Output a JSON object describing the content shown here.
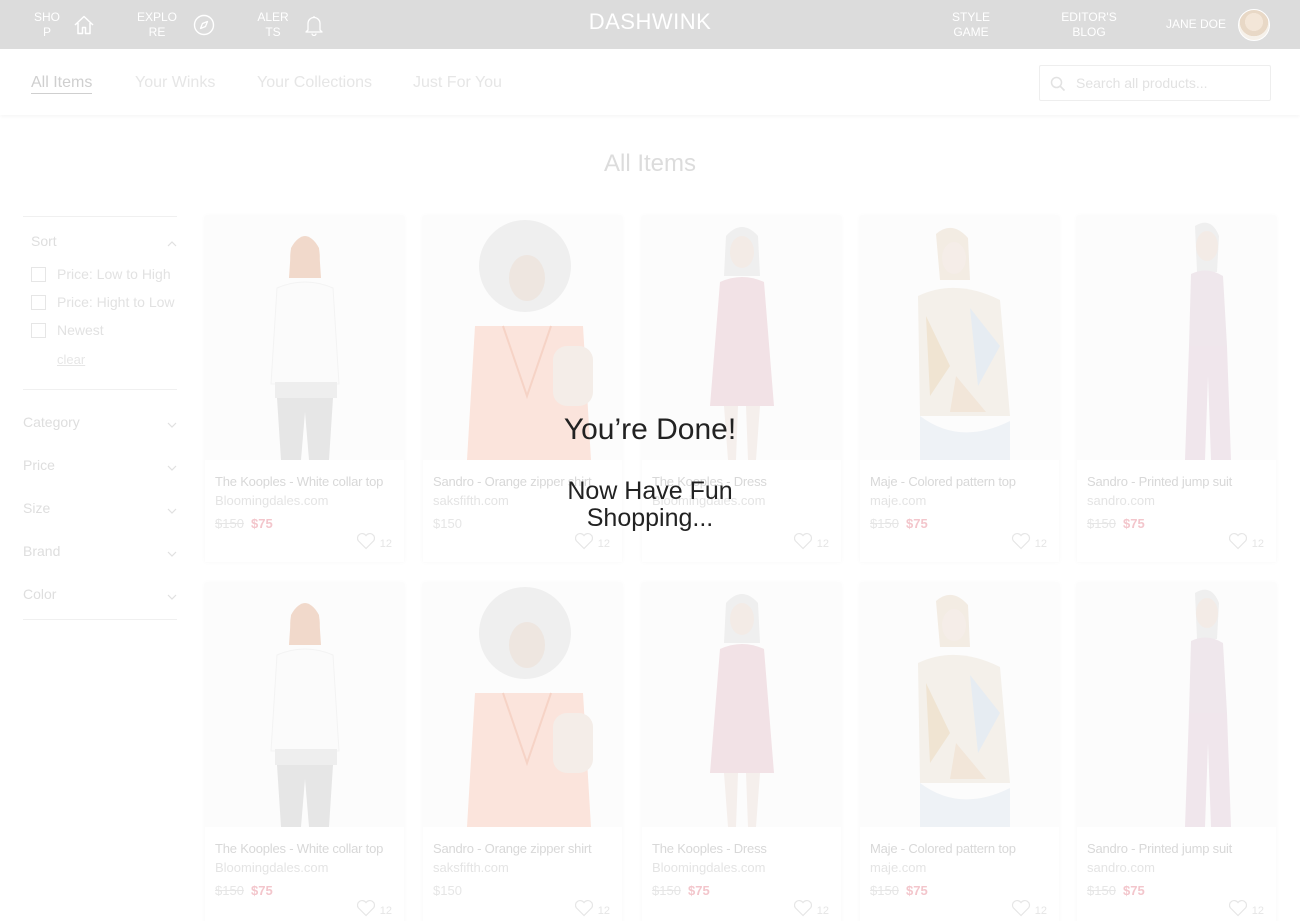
{
  "nav": {
    "shop_label": "SHOP",
    "explore_label": "EXPLORE",
    "alerts_label": "ALERTS",
    "brand": "DASHWINK",
    "style_game_label": "STYLE GAME",
    "editors_blog_label": "EDITOR'S BLOG",
    "user_name": "JANE DOE"
  },
  "tabs": [
    {
      "label": "All Items",
      "active": true
    },
    {
      "label": "Your Winks"
    },
    {
      "label": "Your Collections"
    },
    {
      "label": "Just For You"
    }
  ],
  "search": {
    "placeholder": "Search all products..."
  },
  "page_title": "All Items",
  "sidebar": {
    "sort": {
      "label": "Sort",
      "options": [
        "Price: Low to High",
        "Price: Hight to Low",
        "Newest"
      ],
      "clear_label": "clear"
    },
    "filters": [
      "Category",
      "Price",
      "Size",
      "Brand",
      "Color"
    ]
  },
  "products": [
    {
      "title": "The Kooples - White collar top",
      "store": "Bloomingdales.com",
      "old_price": "$150",
      "new_price": "$75",
      "likes": "12"
    },
    {
      "title": "Sandro - Orange zipper shirt",
      "store": "saksfifth.com",
      "old_price": "$150",
      "new_price": "",
      "likes": "12"
    },
    {
      "title": "The Kooples - Dress",
      "store": "Bloomingdales.com",
      "old_price": "",
      "new_price": "",
      "likes": "12"
    },
    {
      "title": "Maje - Colored pattern top",
      "store": "maje.com",
      "old_price": "$150",
      "new_price": "$75",
      "likes": "12"
    },
    {
      "title": "Sandro - Printed jump suit",
      "store": "sandro.com",
      "old_price": "$150",
      "new_price": "$75",
      "likes": "12"
    },
    {
      "title": "The Kooples - White collar top",
      "store": "Bloomingdales.com",
      "old_price": "$150",
      "new_price": "$75",
      "likes": "12"
    },
    {
      "title": "Sandro - Orange zipper shirt",
      "store": "saksfifth.com",
      "old_price": "$150",
      "new_price": "",
      "likes": "12"
    },
    {
      "title": "The Kooples - Dress",
      "store": "Bloomingdales.com",
      "old_price": "$150",
      "new_price": "$75",
      "likes": "12"
    },
    {
      "title": "Maje - Colored pattern top",
      "store": "maje.com",
      "old_price": "$150",
      "new_price": "$75",
      "likes": "12"
    },
    {
      "title": "Sandro - Printed jump suit",
      "store": "sandro.com",
      "old_price": "$150",
      "new_price": "$75",
      "likes": "12"
    }
  ],
  "overlay": {
    "title": "You’re Done!",
    "subtitle": "Now Have Fun Shopping..."
  },
  "colors": {
    "topbar": "#dcdcdc",
    "sale_price": "#f3c6cc",
    "overlay_text": "#222222"
  },
  "icons": [
    "home-icon",
    "compass-icon",
    "bell-icon",
    "search-icon",
    "chevron-up-icon",
    "chevron-down-icon",
    "heart-icon"
  ]
}
